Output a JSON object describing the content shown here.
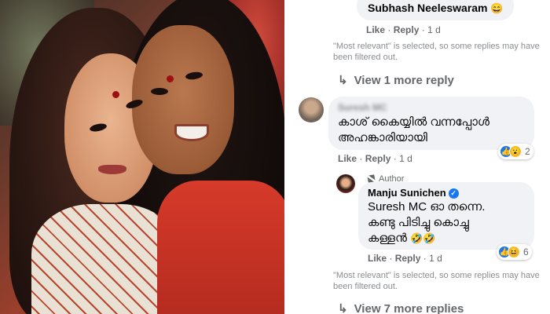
{
  "photo": {
    "icon": "photo-of-two-women"
  },
  "comments": {
    "top_reply": {
      "mention": "Subhash Neeleswaram",
      "emoji": "😄",
      "actions": {
        "like": "Like",
        "reply": "Reply",
        "time": "1 d"
      }
    },
    "filter_note_1": "\"Most relevant\" is selected, so some replies may have been filtered out.",
    "view_more_1": "View 1 more reply",
    "comment_main": {
      "author": "Suresh MC",
      "text_line1": "കാശ് കൈയ്യിൽ വന്നപ്പോൾ",
      "text_line2": "അഹങ്കാരിയായി",
      "actions": {
        "like": "Like",
        "reply": "Reply",
        "time": "1 d"
      },
      "reaction_count": "2",
      "reactions": [
        "like",
        "wow"
      ]
    },
    "author_reply": {
      "badge": "Author",
      "author": "Manju Sunichen",
      "text_line1": "Suresh MC ഓ തന്നെ.",
      "text_line2": "കണ്ടു പിടിച്ചു കൊച്ചു",
      "text_line3": "കള്ളൻ",
      "emoji": "🤣🤣",
      "actions": {
        "like": "Like",
        "reply": "Reply",
        "time": "1 d"
      },
      "reaction_count": "6",
      "reactions": [
        "like",
        "haha"
      ]
    },
    "filter_note_2": "\"Most relevant\" is selected, so some replies may have been filtered out.",
    "view_more_2": "View 7 more replies"
  },
  "colors": {
    "bubble": "#f0f2f5",
    "text": "#050505",
    "muted": "#65676b",
    "facebook_blue": "#1877f2"
  }
}
